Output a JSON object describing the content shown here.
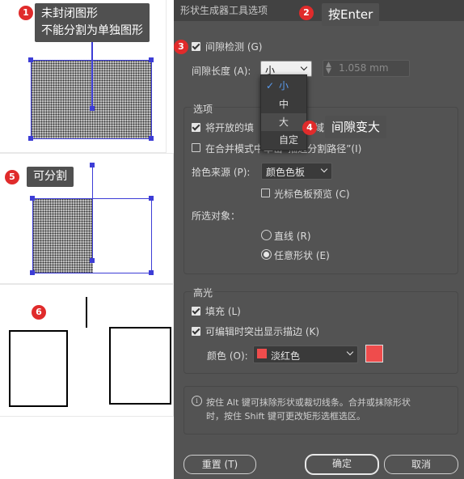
{
  "dialog": {
    "title": "形状生成器工具选项",
    "gap_detection": {
      "label": "间隙检测 (G)",
      "checked": true
    },
    "gap_length": {
      "label": "间隙长度 (A):",
      "value": "小",
      "number": "1.058 mm"
    },
    "gap_options": [
      "小",
      "中",
      "大",
      "自定"
    ],
    "options_section": "选项",
    "fill_open_paths": {
      "label": "将开放的填",
      "suffix": "域",
      "checked": true
    },
    "merge_mode": {
      "label": "在合并模式中单击“描边分割路径”(I)",
      "checked": false
    },
    "pick_color_from": {
      "label": "拾色来源 (P):",
      "value": "颜色色板"
    },
    "cursor_preview": {
      "label": "光标色板预览 (C)",
      "checked": false
    },
    "selection_label": "所选对象：",
    "straight_line": {
      "label": "直线 (R)",
      "checked": false
    },
    "free_shape": {
      "label": "任意形状 (E)",
      "checked": true
    },
    "highlight_section": "高光",
    "fill": {
      "label": "填充 (L)",
      "checked": true
    },
    "editable_stroke": {
      "label": "可编辑时突出显示描边 (K)",
      "checked": true
    },
    "color": {
      "label": "颜色 (O):",
      "value": "淡红色",
      "swatch": "#ef4c4c"
    },
    "hint": [
      "按住 Alt 键可抹除形状或裁切线条。合并或抹除形状",
      "时，按住 Shift 键可更改矩形选框选区。"
    ],
    "reset_button": "重置 (T)",
    "ok_button": "确定",
    "cancel_button": "取消"
  },
  "annotations": {
    "badge1": "1",
    "note1": [
      "未封闭图形",
      "不能分割为单独图形"
    ],
    "badge2": "2",
    "note2": "按Enter",
    "badge3": "3",
    "badge4": "4",
    "note4": "间隙变大",
    "badge5": "5",
    "note5": "可分割",
    "badge6": "6"
  },
  "colors": {
    "accent_badge": "#e02b2b",
    "selection": "#3d3dd6",
    "dialog_bg": "#535353"
  }
}
